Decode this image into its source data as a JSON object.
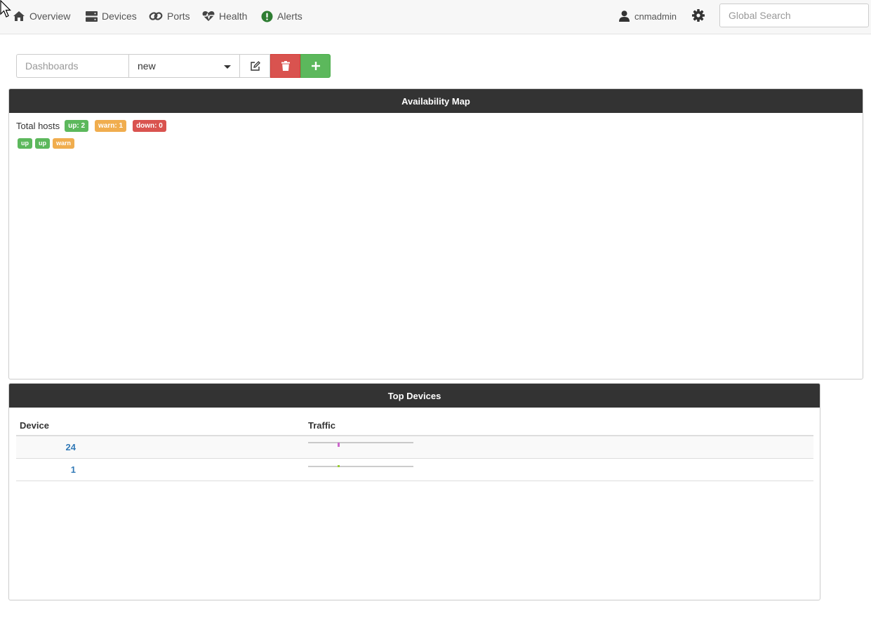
{
  "nav": {
    "items": [
      {
        "label": "Overview",
        "icon": "home-icon"
      },
      {
        "label": "Devices",
        "icon": "server-icon"
      },
      {
        "label": "Ports",
        "icon": "link-icon"
      },
      {
        "label": "Health",
        "icon": "heartbeat-icon"
      },
      {
        "label": "Alerts",
        "icon": "alert-icon"
      }
    ],
    "user": "cnmadmin",
    "search_placeholder": "Global Search"
  },
  "toolbar": {
    "dashboards_label": "Dashboards",
    "selected_dashboard": "new"
  },
  "availability_map": {
    "title": "Availability Map",
    "total_label": "Total hosts",
    "up_badge": "up: 2",
    "warn_badge": "warn: 1",
    "down_badge": "down: 0",
    "hosts": [
      "up",
      "up",
      "warn"
    ]
  },
  "top_devices": {
    "title": "Top Devices",
    "columns": [
      "Device",
      "Traffic"
    ],
    "rows": [
      {
        "device": "24",
        "spark_color": "#cc66cc"
      },
      {
        "device": "1",
        "spark_color": "#99cc33"
      }
    ]
  },
  "colors": {
    "header_bg": "#333333",
    "up": "#5cb85c",
    "warn": "#f0ad4e",
    "down": "#d9534f"
  }
}
